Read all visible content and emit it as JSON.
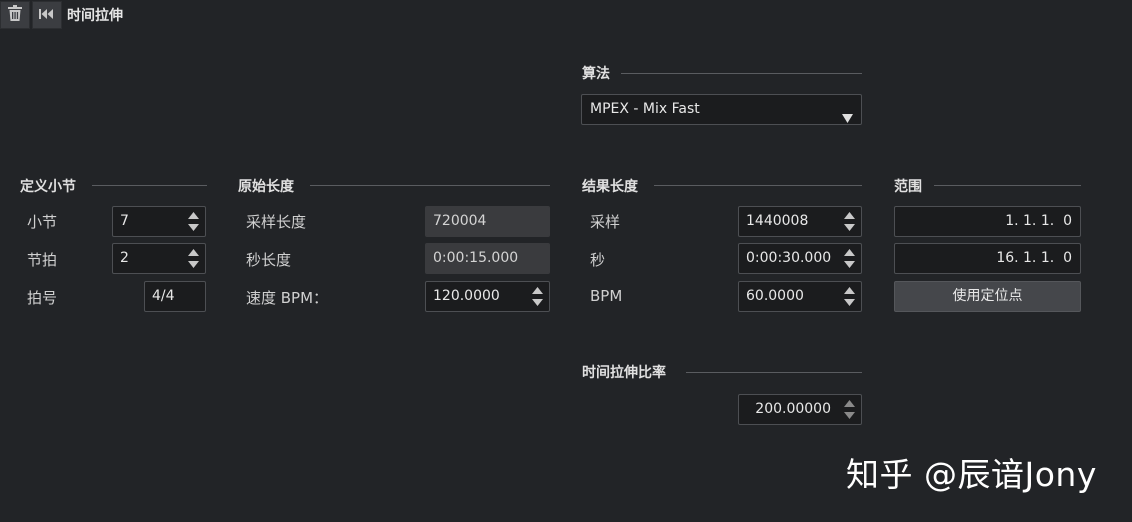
{
  "window": {
    "title": "时间拉伸"
  },
  "toolbar": {
    "delete_icon": "trash-icon",
    "rewind_icon": "skip-to-start-icon"
  },
  "algorithm": {
    "title": "算法",
    "selected": "MPEX - Mix Fast"
  },
  "define_bar": {
    "title": "定义小节",
    "bar_label": "小节",
    "bar_value": "7",
    "beat_label": "节拍",
    "beat_value": "2",
    "signature_label": "拍号",
    "signature_value": "4/4"
  },
  "original_length": {
    "title": "原始长度",
    "samples_label": "采样长度",
    "samples_value": "720004",
    "seconds_label": "秒长度",
    "seconds_value": "0:00:15.000",
    "bpm_label": "速度 BPM：",
    "bpm_value": "120.0000"
  },
  "result_length": {
    "title": "结果长度",
    "samples_label": "采样",
    "samples_value": "1440008",
    "seconds_label": "秒",
    "seconds_value": "0:00:30.000",
    "bpm_label": "BPM",
    "bpm_value": "60.0000"
  },
  "range": {
    "title": "范围",
    "start_value": "1. 1. 1.  0",
    "end_value": "16. 1. 1.  0",
    "use_locators_label": "使用定位点"
  },
  "ratio": {
    "title": "时间拉伸比率",
    "value": "200.00000"
  },
  "watermark": "知乎 @辰谙Jony"
}
